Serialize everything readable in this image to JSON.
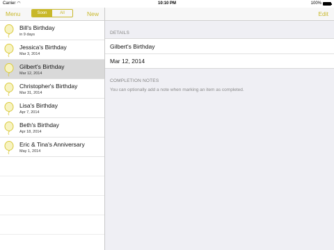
{
  "status_bar": {
    "carrier": "Carrier",
    "time": "10:10 PM",
    "battery": "100%"
  },
  "master": {
    "menu_label": "Menu",
    "new_label": "New",
    "segments": [
      "Soon",
      "All"
    ],
    "active_segment": "Soon",
    "items": [
      {
        "title": "Bill's Birthday",
        "subtitle": "in 9 days",
        "selected": false
      },
      {
        "title": "Jessica's Birthday",
        "subtitle": "Mar 3, 2014",
        "selected": false
      },
      {
        "title": "Gilbert's Birthday",
        "subtitle": "Mar 12, 2014",
        "selected": true
      },
      {
        "title": "Christopher's Birthday",
        "subtitle": "Mar 31, 2014",
        "selected": false
      },
      {
        "title": "Lisa's Birthday",
        "subtitle": "Apr 7, 2014",
        "selected": false
      },
      {
        "title": "Beth's Birthday",
        "subtitle": "Apr 18, 2014",
        "selected": false
      },
      {
        "title": "Eric & Tina's Anniversary",
        "subtitle": "May 1, 2014",
        "selected": false
      }
    ]
  },
  "detail": {
    "edit_label": "Edit",
    "details_header": "DETAILS",
    "detail_title": "Gilbert's Birthday",
    "detail_date": "Mar 12, 2014",
    "notes_header": "COMPLETION NOTES",
    "notes_placeholder": "You can optionally add a note when marking an item as completed."
  },
  "colors": {
    "accent": "#c8b82a",
    "balloon_fill": "#f7f3c2",
    "balloon_stroke": "#d9c93a"
  }
}
